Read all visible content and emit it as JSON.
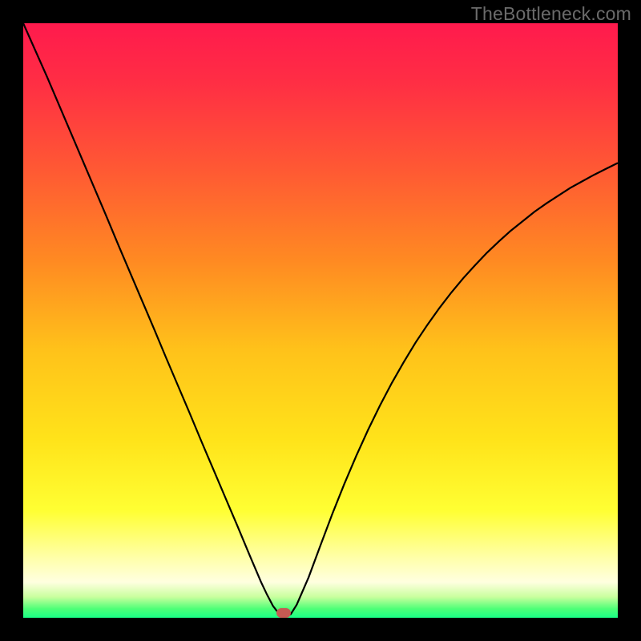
{
  "watermark": "TheBottleneck.com",
  "colors": {
    "frame": "#000000",
    "gradient_stops": [
      {
        "offset": 0.0,
        "color": "#ff1a4d"
      },
      {
        "offset": 0.1,
        "color": "#ff2e44"
      },
      {
        "offset": 0.25,
        "color": "#ff5a33"
      },
      {
        "offset": 0.4,
        "color": "#ff8a22"
      },
      {
        "offset": 0.55,
        "color": "#ffc21a"
      },
      {
        "offset": 0.7,
        "color": "#ffe31a"
      },
      {
        "offset": 0.82,
        "color": "#ffff33"
      },
      {
        "offset": 0.9,
        "color": "#ffffaa"
      },
      {
        "offset": 0.94,
        "color": "#ffffe0"
      },
      {
        "offset": 0.965,
        "color": "#c9ff9e"
      },
      {
        "offset": 0.985,
        "color": "#4eff77"
      },
      {
        "offset": 1.0,
        "color": "#1aff86"
      }
    ],
    "curve": "#000000",
    "marker": "#c65a53"
  },
  "chart_data": {
    "type": "line",
    "title": "",
    "xlabel": "",
    "ylabel": "",
    "x_range": [
      0,
      1
    ],
    "y_range": [
      0,
      1
    ],
    "x": [
      0.0,
      0.02,
      0.04,
      0.06,
      0.08,
      0.1,
      0.12,
      0.14,
      0.16,
      0.18,
      0.2,
      0.22,
      0.24,
      0.26,
      0.28,
      0.3,
      0.32,
      0.34,
      0.36,
      0.38,
      0.4,
      0.41,
      0.42,
      0.43,
      0.44,
      0.45,
      0.46,
      0.48,
      0.5,
      0.52,
      0.54,
      0.56,
      0.58,
      0.6,
      0.62,
      0.64,
      0.66,
      0.68,
      0.7,
      0.72,
      0.74,
      0.76,
      0.78,
      0.8,
      0.82,
      0.84,
      0.86,
      0.88,
      0.9,
      0.92,
      0.94,
      0.96,
      0.98,
      1.0
    ],
    "values": [
      1.0,
      0.955,
      0.91,
      0.863,
      0.816,
      0.769,
      0.722,
      0.675,
      0.627,
      0.58,
      0.533,
      0.486,
      0.438,
      0.391,
      0.344,
      0.296,
      0.249,
      0.202,
      0.155,
      0.107,
      0.06,
      0.039,
      0.02,
      0.007,
      0.001,
      0.006,
      0.022,
      0.068,
      0.122,
      0.175,
      0.225,
      0.272,
      0.316,
      0.357,
      0.395,
      0.43,
      0.463,
      0.493,
      0.521,
      0.547,
      0.571,
      0.593,
      0.614,
      0.633,
      0.651,
      0.667,
      0.683,
      0.697,
      0.71,
      0.723,
      0.734,
      0.745,
      0.755,
      0.765
    ],
    "marker": {
      "x": 0.438,
      "y": 0.0
    },
    "note": "x and y are normalized to the plot area; y increases upward"
  }
}
